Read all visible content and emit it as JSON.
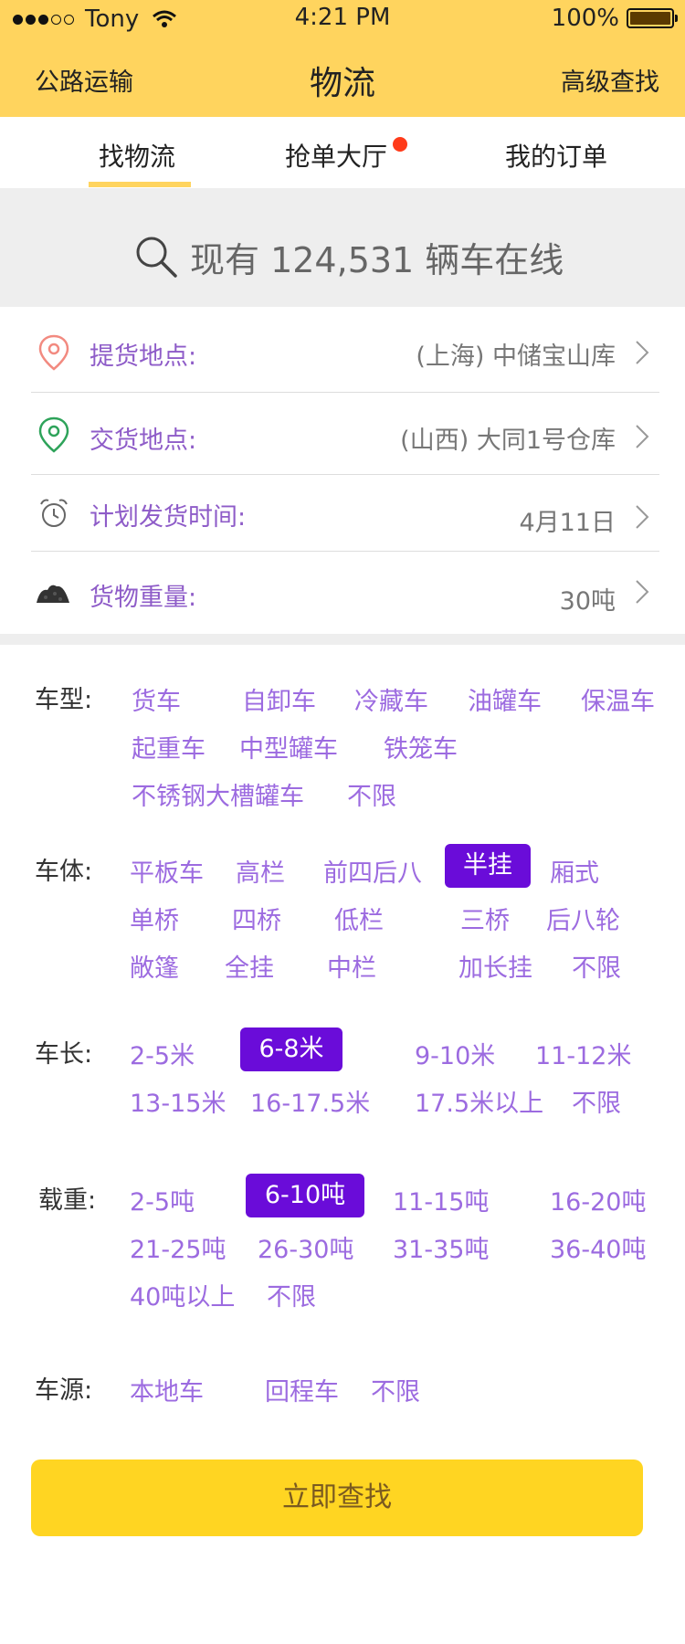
{
  "status": {
    "carrier": "Tony",
    "time": "4:21 PM",
    "battery": "100%"
  },
  "nav": {
    "left": "公路运输",
    "title": "物流",
    "right": "高级查找"
  },
  "tabs": [
    {
      "label": "找物流"
    },
    {
      "label": "抢单大厅"
    },
    {
      "label": "我的订单"
    }
  ],
  "search": {
    "text": "现有 124,531 辆车在线"
  },
  "form": {
    "pickup": {
      "label": "提货地点:",
      "value": "(上海) 中储宝山库"
    },
    "delivery": {
      "label": "交货地点:",
      "value": "(山西) 大同1号仓库"
    },
    "ship_time": {
      "label": "计划发货时间:",
      "value": "4月11日"
    },
    "weight": {
      "label": "货物重量:",
      "value": "30吨"
    }
  },
  "filters": {
    "vehicle_type": {
      "label": "车型:",
      "options": [
        "货车",
        "自卸车",
        "冷藏车",
        "油罐车",
        "保温车",
        "起重车",
        "中型罐车",
        "铁笼车",
        "不锈钢大槽罐车",
        "不限"
      ]
    },
    "body": {
      "label": "车体:",
      "options": [
        "平板车",
        "高栏",
        "前四后八",
        "半挂",
        "厢式",
        "单桥",
        "四桥",
        "低栏",
        "三桥",
        "后八轮",
        "敞篷",
        "全挂",
        "中栏",
        "加长挂",
        "不限"
      ]
    },
    "length": {
      "label": "车长:",
      "options": [
        "2-5米",
        "6-8米",
        "9-10米",
        "11-12米",
        "13-15米",
        "16-17.5米",
        "17.5米以上",
        "不限"
      ]
    },
    "load": {
      "label": "载重:",
      "options": [
        "2-5吨",
        "6-10吨",
        "11-15吨",
        "16-20吨",
        "21-25吨",
        "26-30吨",
        "31-35吨",
        "36-40吨",
        "40吨以上",
        "不限"
      ]
    },
    "source": {
      "label": "车源:",
      "options": [
        "本地车",
        "回程车",
        "不限"
      ]
    }
  },
  "cta": {
    "label": "立即查找"
  },
  "colors": {
    "header": "#FFD45E",
    "accent": "#6A0CD9",
    "chip": "#9C6BE0",
    "button": "#FFD522"
  }
}
